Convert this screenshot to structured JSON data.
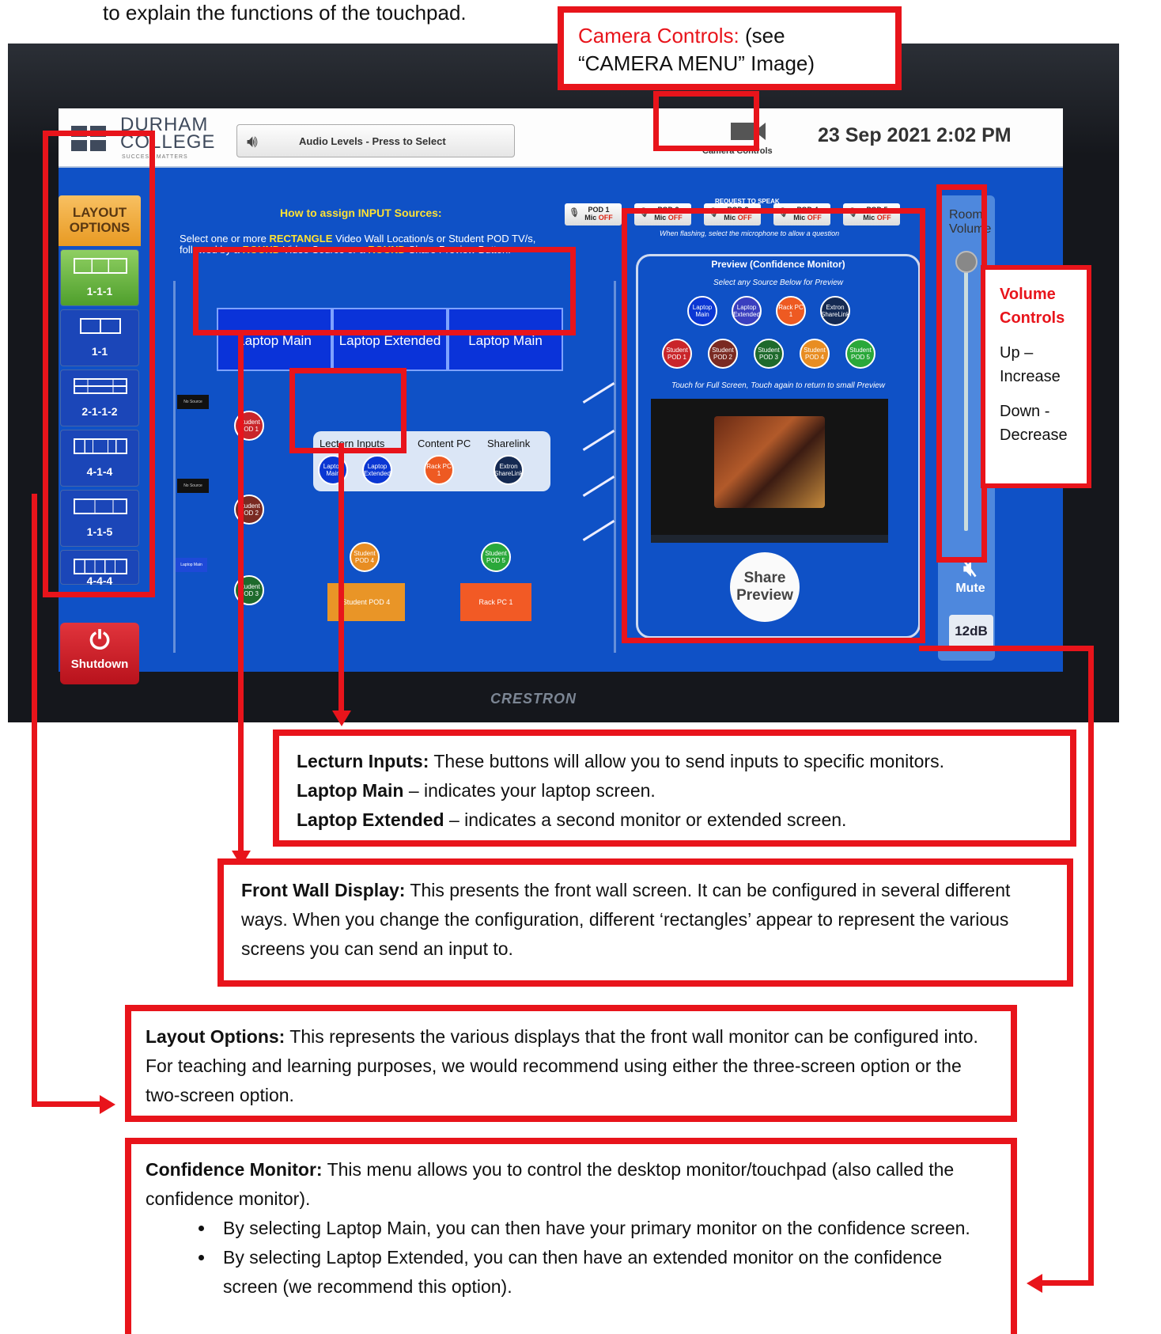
{
  "intro_text": "to explain the functions of the touchpad.",
  "touchpad": {
    "logo_line1": "DURHAM",
    "logo_line2": "COLLEGE",
    "logo_tagline": "SUCCESS MATTERS",
    "audio_button_label": "Audio Levels - Press to Select",
    "camera_button_label": "Camera Controls",
    "datetime": "23 Sep 2021 2:02 PM",
    "layout_header": "LAYOUT OPTIONS",
    "layouts": [
      "1-1-1",
      "1-1",
      "2-1-1-2",
      "4-1-4",
      "1-1-5",
      "4-4-4"
    ],
    "shutdown_label": "Shutdown",
    "howto_title": "How to assign INPUT Sources:",
    "instructions": {
      "p1": "Select one or more ",
      "k1": "RECTANGLE",
      "p2": " Video Wall Location/s or Student POD TV/s, followed by a ",
      "k2": "ROUND",
      "p3": " Video Source or a ",
      "k3": "ROUND",
      "p4": " Share Preview Button."
    },
    "request_to_speak": "REQUEST TO SPEAK",
    "pod_mics": [
      {
        "pod": "POD 1",
        "mic": "Mic",
        "state": "OFF"
      },
      {
        "pod": "POD 2",
        "mic": "Mic",
        "state": "OFF"
      },
      {
        "pod": "POD 3",
        "mic": "Mic",
        "state": "OFF"
      },
      {
        "pod": "POD 4",
        "mic": "Mic",
        "state": "OFF"
      },
      {
        "pod": "POD 5",
        "mic": "Mic",
        "state": "OFF"
      }
    ],
    "pods_note": "When flashing, select the microphone to allow a question",
    "wall_screens": [
      "Laptop Main",
      "Laptop Extended",
      "Laptop Main"
    ],
    "no_source": "No Source",
    "side_laptop_main": "Laptop Main",
    "student_pods_round": [
      "Student POD 1",
      "Student POD 2",
      "Student POD 3",
      "Student POD 4",
      "Student POD 5"
    ],
    "lectern_inputs_label": "Lectern Inputs",
    "content_pc_label": "Content PC",
    "sharelink_label": "Sharelink",
    "round_laptop_main": "Laptop Main",
    "round_laptop_extended": "Laptop Extended",
    "round_rack_pc": "Rack PC 1",
    "round_extron": "Extron ShareLink",
    "square_student_pod4": "Student POD 4",
    "square_rack_pc1": "Rack PC 1",
    "preview_title": "Preview (Confidence Monitor)",
    "preview_sub": "Select any Source Below for Preview",
    "preview_note": "Touch for Full Screen, Touch again to return to small Preview",
    "preview_sources_row1": [
      "Laptop Main",
      "Laptop Extended",
      "Rack PC 1",
      "Extron ShareLink"
    ],
    "preview_sources_row2": [
      "Student POD 1",
      "Student POD 2",
      "Student POD 3",
      "Student POD 4",
      "Student POD 5"
    ],
    "share_preview_label": "Share Preview",
    "room_volume_label": "Room Volume",
    "mute_label": "Mute",
    "volume_db": "12dB",
    "bezel_brand": "CRESTRON"
  },
  "callouts": {
    "camera_red": "Camera Controls:",
    "camera_rest": " (see “CAMERA MENU” Image)",
    "volume_title": "Volume Controls",
    "volume_up": "Up – Increase",
    "volume_down": "Down - Decrease",
    "lectern_title": "Lecturn Inputs:",
    "lectern_text": " These buttons will allow you to send inputs to specific monitors.",
    "lectern_main_b": "Laptop Main",
    "lectern_main_t": " – indicates your laptop screen.",
    "lectern_ext_b": "Laptop Extended",
    "lectern_ext_t": " – indicates a second monitor or extended screen.",
    "front_title": "Front Wall Display:",
    "front_text": " This presents the front wall screen. It can be configured in several different ways. When you change the configuration, different ‘rectangles’ appear to represent the various screens you can send an input to.",
    "layout_title": "Layout Options:",
    "layout_text": " This represents the various displays that the front wall monitor can be configured into. For teaching and learning purposes, we would recommend using either the three-screen option or the two-screen option.",
    "conf_title": "Confidence Monitor:",
    "conf_text": " This menu allows you to control the desktop monitor/touchpad (also called the confidence monitor).",
    "conf_bullets": [
      "By selecting Laptop Main, you can then have your primary monitor on the confidence screen.",
      "By selecting Laptop Extended, you can then have an extended monitor on the confidence screen (we recommend this option)."
    ]
  },
  "colors": {
    "callout_red": "#e8141b",
    "screen_blue": "#0f51c6",
    "highlight_yellow": "#ffe233",
    "layout_orange": "#e89a23",
    "shutdown_red": "#c8141c"
  }
}
